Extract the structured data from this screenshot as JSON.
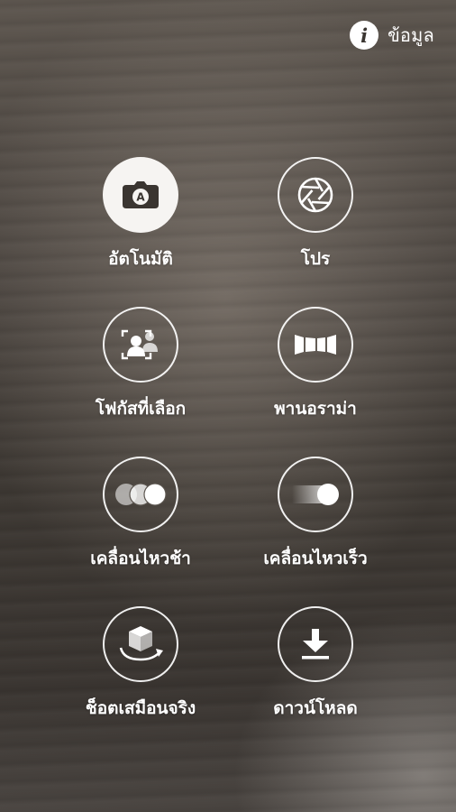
{
  "header": {
    "info_label": "ข้อมูล",
    "info_icon": "info-icon"
  },
  "modes": [
    {
      "label": "อัตโนมัติ",
      "icon": "auto-camera-icon",
      "selected": true
    },
    {
      "label": "โปร",
      "icon": "aperture-icon",
      "selected": false
    },
    {
      "label": "โฟกัสที่เลือก",
      "icon": "selective-focus-icon",
      "selected": false
    },
    {
      "label": "พานอราม่า",
      "icon": "panorama-icon",
      "selected": false
    },
    {
      "label": "เคลื่อนไหวช้า",
      "icon": "slow-motion-icon",
      "selected": false
    },
    {
      "label": "เคลื่อนไหวเร็ว",
      "icon": "fast-motion-icon",
      "selected": false
    },
    {
      "label": "ช็อตเสมือนจริง",
      "icon": "virtual-shot-icon",
      "selected": false
    },
    {
      "label": "ดาวน์โหลด",
      "icon": "download-icon",
      "selected": false
    }
  ],
  "colors": {
    "icon_dark": "#3a3531",
    "icon_light": "#ffffff",
    "active_fill": "#f6f4f2"
  }
}
